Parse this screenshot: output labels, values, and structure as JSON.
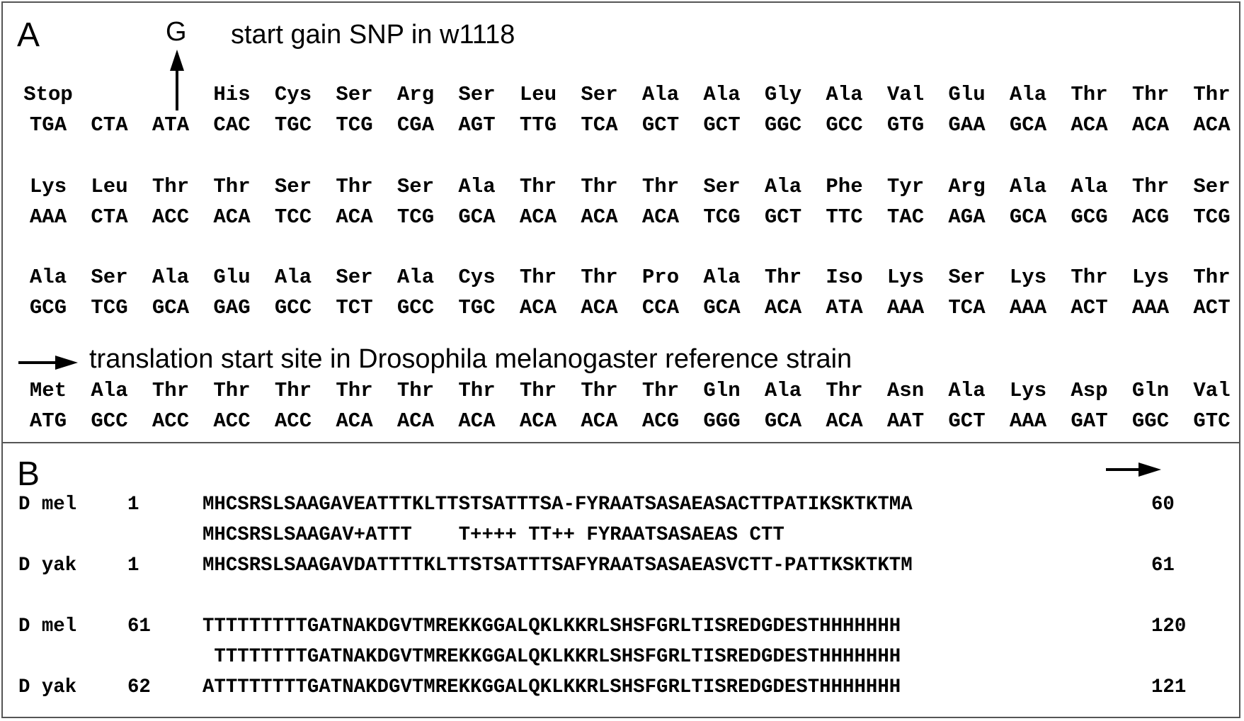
{
  "panel_a": {
    "letter": "A",
    "snp_base": "G",
    "snp_label": "start gain SNP in w1118",
    "reference_note": "translation start site in Drosophila melanogaster reference strain",
    "blocks": [
      {
        "aa": [
          "Stop",
          "",
          "",
          "His",
          "Cys",
          "Ser",
          "Arg",
          "Ser",
          "Leu",
          "Ser",
          "Ala",
          "Ala",
          "Gly",
          "Ala",
          "Val",
          "Glu",
          "Ala",
          "Thr",
          "Thr",
          "Thr"
        ],
        "nt": [
          "TGA",
          "CTA",
          "ATA",
          "CAC",
          "TGC",
          "TCG",
          "CGA",
          "AGT",
          "TTG",
          "TCA",
          "GCT",
          "GCT",
          "GGC",
          "GCC",
          "GTG",
          "GAA",
          "GCA",
          "ACA",
          "ACA",
          "ACA"
        ]
      },
      {
        "aa": [
          "Lys",
          "Leu",
          "Thr",
          "Thr",
          "Ser",
          "Thr",
          "Ser",
          "Ala",
          "Thr",
          "Thr",
          "Thr",
          "Ser",
          "Ala",
          "Phe",
          "Tyr",
          "Arg",
          "Ala",
          "Ala",
          "Thr",
          "Ser"
        ],
        "nt": [
          "AAA",
          "CTA",
          "ACC",
          "ACA",
          "TCC",
          "ACA",
          "TCG",
          "GCA",
          "ACA",
          "ACA",
          "ACA",
          "TCG",
          "GCT",
          "TTC",
          "TAC",
          "AGA",
          "GCA",
          "GCG",
          "ACG",
          "TCG"
        ]
      },
      {
        "aa": [
          "Ala",
          "Ser",
          "Ala",
          "Glu",
          "Ala",
          "Ser",
          "Ala",
          "Cys",
          "Thr",
          "Thr",
          "Pro",
          "Ala",
          "Thr",
          "Iso",
          "Lys",
          "Ser",
          "Lys",
          "Thr",
          "Lys",
          "Thr"
        ],
        "nt": [
          "GCG",
          "TCG",
          "GCA",
          "GAG",
          "GCC",
          "TCT",
          "GCC",
          "TGC",
          "ACA",
          "ACA",
          "CCA",
          "GCA",
          "ACA",
          "ATA",
          "AAA",
          "TCA",
          "AAA",
          "ACT",
          "AAA",
          "ACT"
        ]
      },
      {
        "aa": [
          "Met",
          "Ala",
          "Thr",
          "Thr",
          "Thr",
          "Thr",
          "Thr",
          "Thr",
          "Thr",
          "Thr",
          "Thr",
          "Gln",
          "Ala",
          "Thr",
          "Asn",
          "Ala",
          "Lys",
          "Asp",
          "Gln",
          "Val"
        ],
        "nt": [
          "ATG",
          "GCC",
          "ACC",
          "ACC",
          "ACC",
          "ACA",
          "ACA",
          "ACA",
          "ACA",
          "ACA",
          "ACG",
          "GGG",
          "GCA",
          "ACA",
          "AAT",
          "GCT",
          "AAA",
          "GAT",
          "GGC",
          "GTC"
        ]
      }
    ]
  },
  "panel_b": {
    "letter": "B",
    "rows": [
      {
        "label": "D mel",
        "start": "1",
        "seq": "MHCSRSLSAAGAVEATTTKLTTSTSATTTSA-FYRAATSASAEASACTTPATIKSKTKTMA",
        "end": "60"
      },
      {
        "label": "",
        "start": "",
        "seq": "MHCSRSLSAAGAV+ATTT    T++++ TT++ FYRAATSASAEAS CTT",
        "end": ""
      },
      {
        "label": "D yak",
        "start": "1",
        "seq": "MHCSRSLSAAGAVDATTTTKLTTSTSATTTSAFYRAATSASAEASVCTT-PATTKSKTKTM",
        "end": "61"
      },
      {
        "label": "D mel",
        "start": "61",
        "seq": "TTTTTTTTTGATNAKDGVTMREKKGGALQKLKKRLSHSFGRLTISREDGDESTHHHHHHH",
        "end": "120"
      },
      {
        "label": "",
        "start": "",
        "seq": " TTTTTTTTGATNAKDGVTMREKKGGALQKLKKRLSHSFGRLTISREDGDESTHHHHHHH",
        "end": ""
      },
      {
        "label": "D yak",
        "start": "62",
        "seq": "ATTTTTTTTGATNAKDGVTMREKKGGALQKLKKRLSHSFGRLTISREDGDESTHHHHHHH",
        "end": "121"
      }
    ]
  }
}
